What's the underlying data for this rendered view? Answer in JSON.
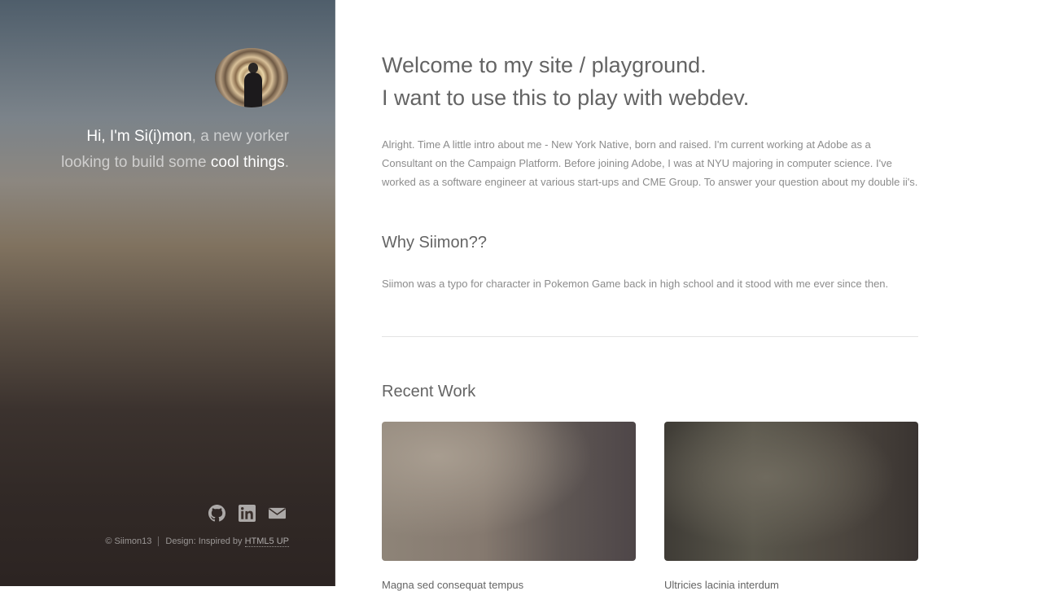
{
  "sidebar": {
    "intro": {
      "name": "Hi, I'm Si(i)mon",
      "middle": ", a new yorker looking to build some ",
      "emphasis": "cool things",
      "end": "."
    },
    "social": [
      {
        "icon": "github-icon",
        "label": "GitHub"
      },
      {
        "icon": "linkedin-icon",
        "label": "LinkedIn"
      },
      {
        "icon": "envelope-icon",
        "label": "Email"
      }
    ],
    "credits": {
      "copyright": "© Siimon13",
      "design_prefix": "Design: Inspired by ",
      "design_link": "HTML5 UP"
    }
  },
  "main": {
    "welcome_line1": "Welcome to my site / playground.",
    "welcome_line2": "I want to use this to play with webdev.",
    "about": "Alright. Time A little intro about me - New York Native, born and raised. I'm current working at Adobe as a Consultant on the Campaign Platform. Before joining Adobe, I was at NYU majoring in computer science. I've worked as a software engineer at various start-ups and CME Group. To answer your question about my double ii's.",
    "why_heading": "Why Siimon??",
    "why_text": "Siimon was a typo for character in Pokemon Game back in high school and it stood with me ever since then.",
    "recent_heading": "Recent Work",
    "work": [
      {
        "caption": "Magna sed consequat tempus"
      },
      {
        "caption": "Ultricies lacinia interdum"
      }
    ]
  }
}
